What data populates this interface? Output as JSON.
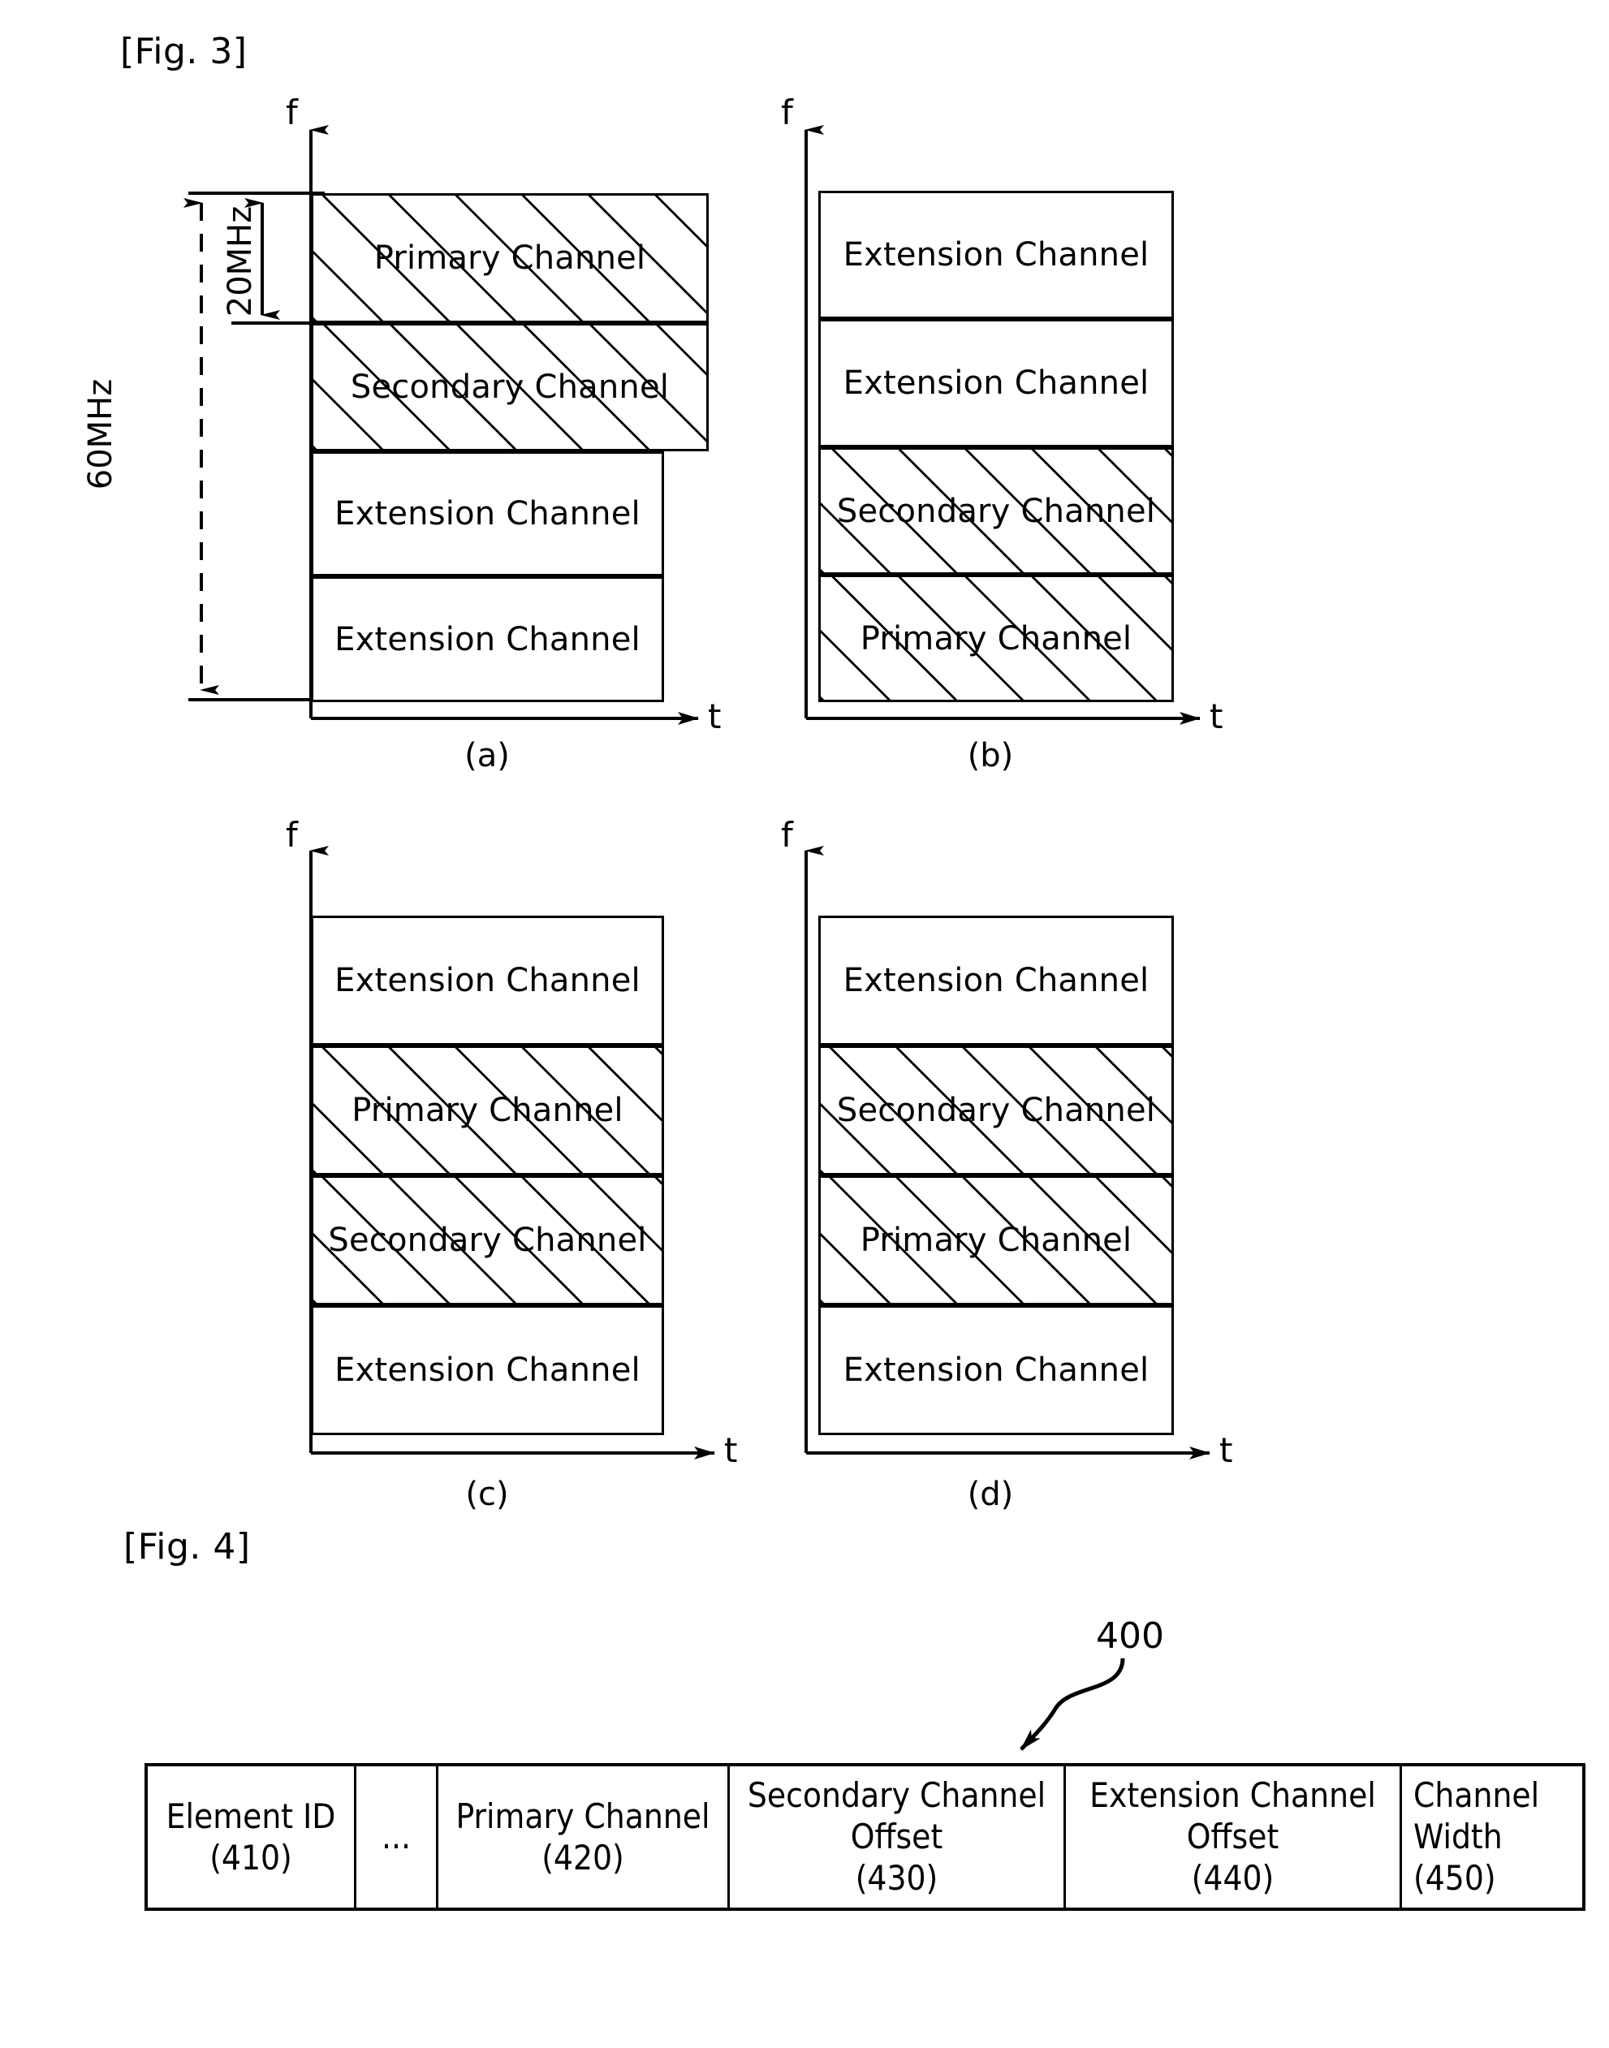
{
  "figures": {
    "fig3": {
      "label": "[Fig. 3]"
    },
    "fig4": {
      "label": "[Fig. 4]"
    }
  },
  "axes": {
    "frequency": "f",
    "time": "t"
  },
  "bandwidth_annotations": {
    "total": "60MHz",
    "single_channel": "20MHz"
  },
  "panels": [
    {
      "id": "a",
      "caption": "(a)",
      "rows": [
        {
          "label": "Primary Channel",
          "hatched": true,
          "wide": true
        },
        {
          "label": "Secondary Channel",
          "hatched": true,
          "wide": true
        },
        {
          "label": "Extension Channel",
          "hatched": false,
          "wide": false
        },
        {
          "label": "Extension Channel",
          "hatched": false,
          "wide": false
        }
      ]
    },
    {
      "id": "b",
      "caption": "(b)",
      "rows": [
        {
          "label": "Extension Channel",
          "hatched": false,
          "wide": false
        },
        {
          "label": "Extension Channel",
          "hatched": false,
          "wide": false
        },
        {
          "label": "Secondary Channel",
          "hatched": true,
          "wide": true
        },
        {
          "label": "Primary Channel",
          "hatched": true,
          "wide": true
        }
      ]
    },
    {
      "id": "c",
      "caption": "(c)",
      "rows": [
        {
          "label": "Extension Channel",
          "hatched": false,
          "wide": false
        },
        {
          "label": "Primary Channel",
          "hatched": true,
          "wide": false
        },
        {
          "label": "Secondary Channel",
          "hatched": true,
          "wide": false
        },
        {
          "label": "Extension Channel",
          "hatched": false,
          "wide": false
        }
      ]
    },
    {
      "id": "d",
      "caption": "(d)",
      "rows": [
        {
          "label": "Extension Channel",
          "hatched": false,
          "wide": false
        },
        {
          "label": "Secondary Channel",
          "hatched": true,
          "wide": false
        },
        {
          "label": "Primary Channel",
          "hatched": true,
          "wide": false
        },
        {
          "label": "Extension Channel",
          "hatched": false,
          "wide": false
        }
      ]
    }
  ],
  "fig4": {
    "reference_number": "400",
    "cells": [
      {
        "line1": "Element ID",
        "line2": "(410)",
        "line3": ""
      },
      {
        "line1": "...",
        "line2": "",
        "line3": ""
      },
      {
        "line1": "Primary Channel",
        "line2": "(420)",
        "line3": ""
      },
      {
        "line1": "Secondary Channel",
        "line2": "Offset",
        "line3": "(430)"
      },
      {
        "line1": "Extension Channel",
        "line2": "Offset",
        "line3": "(440)"
      },
      {
        "line1": "Channel",
        "line2": "Width",
        "line3": "(450)"
      }
    ]
  }
}
